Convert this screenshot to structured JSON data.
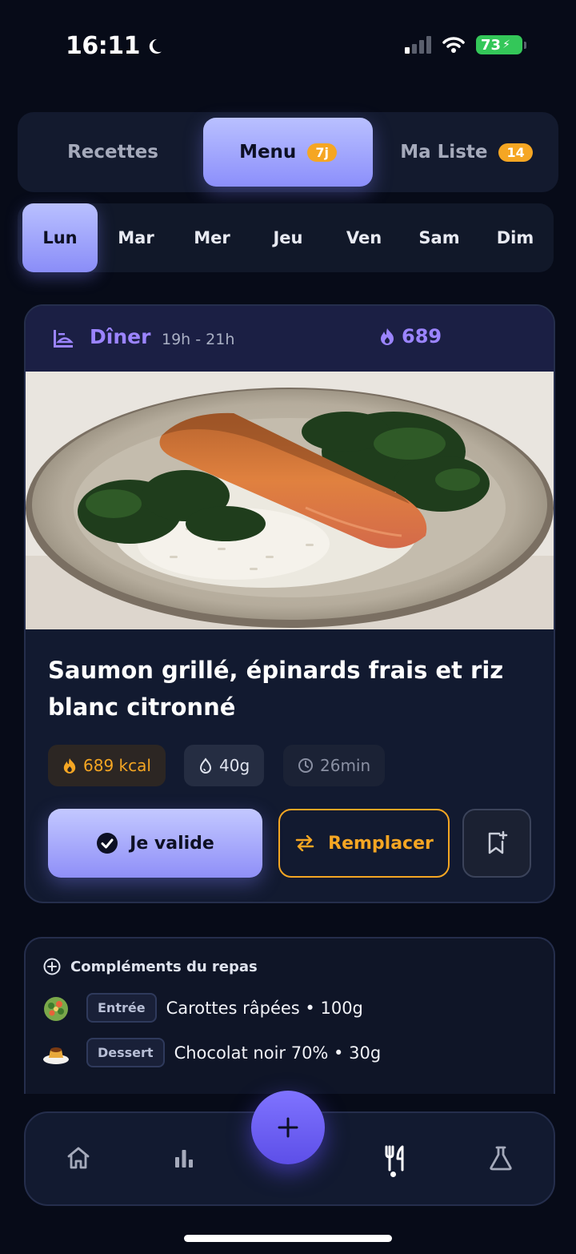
{
  "status": {
    "time": "16:11",
    "battery": "73"
  },
  "tabs": [
    {
      "label": "Recettes"
    },
    {
      "label": "Menu",
      "badge": "7j"
    },
    {
      "label": "Ma Liste",
      "badge": "14"
    }
  ],
  "days": [
    "Lun",
    "Mar",
    "Mer",
    "Jeu",
    "Ven",
    "Sam",
    "Dim"
  ],
  "meal": {
    "title": "Dîner",
    "time_range": "19h - 21h",
    "calories": "689",
    "name": "Saumon grillé, épinards frais et riz blanc citronné",
    "chips": {
      "kcal": "689 kcal",
      "protein": "40g",
      "duration": "26min"
    },
    "validate_label": "Je valide",
    "replace_label": "Remplacer"
  },
  "complements": {
    "title": "Compléments du repas",
    "items": [
      {
        "tag": "Entrée",
        "text": "Carottes râpées • 100g"
      },
      {
        "tag": "Dessert",
        "text": "Chocolat noir 70% • 30g"
      }
    ]
  },
  "colors": {
    "background": "#070b18",
    "accent_violet": "#9b84ff",
    "accent_orange": "#f5a623",
    "fab": "#6f63f7"
  },
  "icons": [
    "moon-icon",
    "signal-icon",
    "wifi-icon",
    "battery-icon",
    "meal-icon",
    "flame-icon",
    "drop-icon",
    "clock-icon",
    "check-icon",
    "swap-icon",
    "bookmark-add-icon",
    "plus-circle-icon",
    "salad-icon",
    "flan-icon",
    "home-icon",
    "stats-icon",
    "plus-icon",
    "cutlery-icon",
    "flask-icon"
  ]
}
